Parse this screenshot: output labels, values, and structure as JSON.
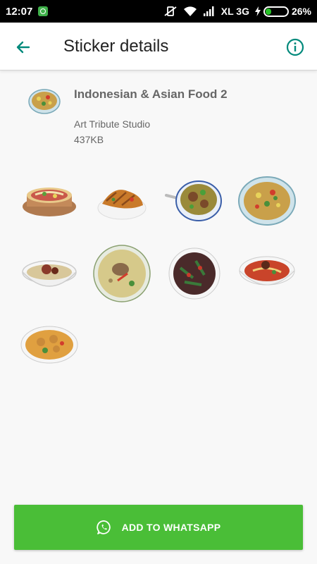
{
  "status_bar": {
    "time": "12:07",
    "carrier": "XL 3G",
    "battery": "26%",
    "battery_level": 0.26
  },
  "app_bar": {
    "title": "Sticker details",
    "back_icon": "arrow-back-icon",
    "info_icon": "info-circle-icon"
  },
  "pack": {
    "name": "Indonesian & Asian Food 2",
    "publisher": "Art Tribute Studio",
    "size": "437KB"
  },
  "stickers": [
    {
      "icon": "noodle-clay-pot-sticker"
    },
    {
      "icon": "fried-noodles-plate-sticker"
    },
    {
      "icon": "meatball-soup-bowl-sticker"
    },
    {
      "icon": "noodle-bowl-sticker"
    },
    {
      "icon": "meat-noodle-bowl-sticker"
    },
    {
      "icon": "chicken-soup-sticker"
    },
    {
      "icon": "stir-fried-vegetables-sticker"
    },
    {
      "icon": "beef-noodle-soup-sticker"
    },
    {
      "icon": "curry-chicken-bowl-sticker"
    }
  ],
  "add_button": {
    "label": "ADD TO WHATSAPP",
    "icon": "whatsapp-icon"
  },
  "colors": {
    "accent": "#00897b",
    "button": "#4abe37"
  }
}
